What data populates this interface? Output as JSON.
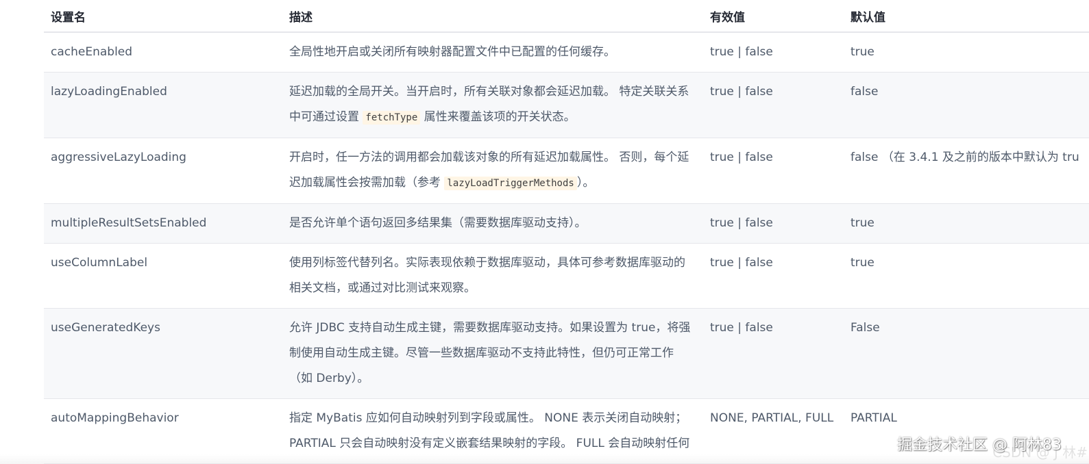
{
  "table": {
    "headers": [
      "设置名",
      "描述",
      "有效值",
      "默认值"
    ],
    "rows": [
      {
        "name": "cacheEnabled",
        "desc_lines": [
          [
            {
              "t": "全局性地开启或关闭所有映射器配置文件中已配置的任何缓存。"
            }
          ]
        ],
        "valid": "true | false",
        "default": "true"
      },
      {
        "name": "lazyLoadingEnabled",
        "desc_lines": [
          [
            {
              "t": "延迟加载的全局开关。当开启时，所有关联对象都会延迟加载。 特定关联关系"
            }
          ],
          [
            {
              "t": "中可通过设置 "
            },
            {
              "code": "fetchType"
            },
            {
              "t": " 属性来覆盖该项的开关状态。"
            }
          ]
        ],
        "valid": "true | false",
        "default": "false"
      },
      {
        "name": "aggressiveLazyLoading",
        "desc_lines": [
          [
            {
              "t": "开启时，任一方法的调用都会加载该对象的所有延迟加载属性。 否则，每个延"
            }
          ],
          [
            {
              "t": "迟加载属性会按需加载（参考 "
            },
            {
              "code": "lazyLoadTriggerMethods"
            },
            {
              "t": "）。"
            }
          ]
        ],
        "valid": "true | false",
        "default": "false （在 3.4.1 及之前的版本中默认为 tru"
      },
      {
        "name": "multipleResultSetsEnabled",
        "desc_lines": [
          [
            {
              "t": "是否允许单个语句返回多结果集（需要数据库驱动支持）。"
            }
          ]
        ],
        "valid": "true | false",
        "default": "true"
      },
      {
        "name": "useColumnLabel",
        "desc_lines": [
          [
            {
              "t": "使用列标签代替列名。实际表现依赖于数据库驱动，具体可参考数据库驱动的"
            }
          ],
          [
            {
              "t": "相关文档，或通过对比测试来观察。"
            }
          ]
        ],
        "valid": "true | false",
        "default": "true"
      },
      {
        "name": "useGeneratedKeys",
        "desc_lines": [
          [
            {
              "t": "允许 JDBC 支持自动生成主键，需要数据库驱动支持。如果设置为 true，将强"
            }
          ],
          [
            {
              "t": "制使用自动生成主键。尽管一些数据库驱动不支持此特性，但仍可正常工作"
            }
          ],
          [
            {
              "t": "（如 Derby）。"
            }
          ]
        ],
        "valid": "true | false",
        "default": "False"
      },
      {
        "name": "autoMappingBehavior",
        "desc_lines": [
          [
            {
              "t": "指定 MyBatis 应如何自动映射列到字段或属性。 NONE 表示关闭自动映射；"
            }
          ],
          [
            {
              "t": "PARTIAL 只会自动映射没有定义嵌套结果映射的字段。 FULL 会自动映射任何"
            }
          ]
        ],
        "valid": "NONE, PARTIAL, FULL",
        "default": "PARTIAL"
      }
    ]
  },
  "watermark": "掘金技术社区 @ 阿林83",
  "watermark_faint": "CSDN @ J 林#"
}
